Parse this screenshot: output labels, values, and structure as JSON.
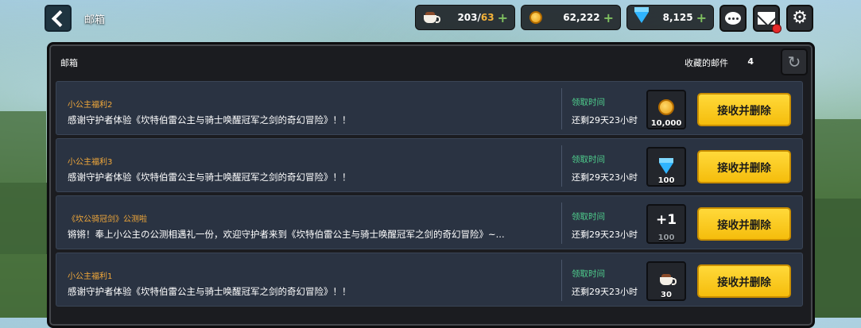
{
  "header": {
    "title": "邮箱",
    "resources": [
      {
        "icon": "coffee-cup-icon",
        "current": "203",
        "separator": "/",
        "max": "63"
      },
      {
        "icon": "gold-coin-icon",
        "value": "62,222"
      },
      {
        "icon": "diamond-gem-icon",
        "value": "8,125"
      }
    ],
    "plus_symbol": "+"
  },
  "panel": {
    "title": "邮箱",
    "saved_label": "收藏的邮件",
    "saved_count": "4"
  },
  "mails": [
    {
      "sender": "小公主福利2",
      "body": "感谢守护者体验《坎特伯雷公主与骑士唤醒冠军之剑的奇幻冒险》！！",
      "time_label": "领取时间",
      "time_left": "还剩29天23小时",
      "reward_icon": "gold-coin-icon",
      "reward_qty": "10,000",
      "button": "接收并删除"
    },
    {
      "sender": "小公主福利3",
      "body": "感谢守护者体验《坎特伯雷公主与骑士唤醒冠军之剑的奇幻冒险》！！",
      "time_label": "领取时间",
      "time_left": "还剩29天23小时",
      "reward_icon": "diamond-gem-icon",
      "reward_qty": "100",
      "button": "接收并删除"
    },
    {
      "sender": "《坎公骑冠剑》公测啦",
      "body": "锵锵！奉上小公主の公测相遇礼一份，欢迎守护者来到《坎特伯雷公主与骑士唤醒冠军之剑的奇幻冒险》~...",
      "time_label": "领取时间",
      "time_left": "还剩29天23小时",
      "reward_icon": "plus-one-icon",
      "reward_text": "+1",
      "reward_qty": "100",
      "button": "接收并删除"
    },
    {
      "sender": "小公主福利1",
      "body": "感谢守护者体验《坎特伯雷公主与骑士唤醒冠军之剑的奇幻冒险》！！",
      "time_label": "领取时间",
      "time_left": "还剩29天23小时",
      "reward_icon": "coffee-cup-icon",
      "reward_qty": "30",
      "button": "接收并删除"
    }
  ],
  "colors": {
    "accent_button": "#f5bd0c",
    "sender": "#f3a93a",
    "time_label": "#4fd08e",
    "notification": "#e62a2a"
  }
}
